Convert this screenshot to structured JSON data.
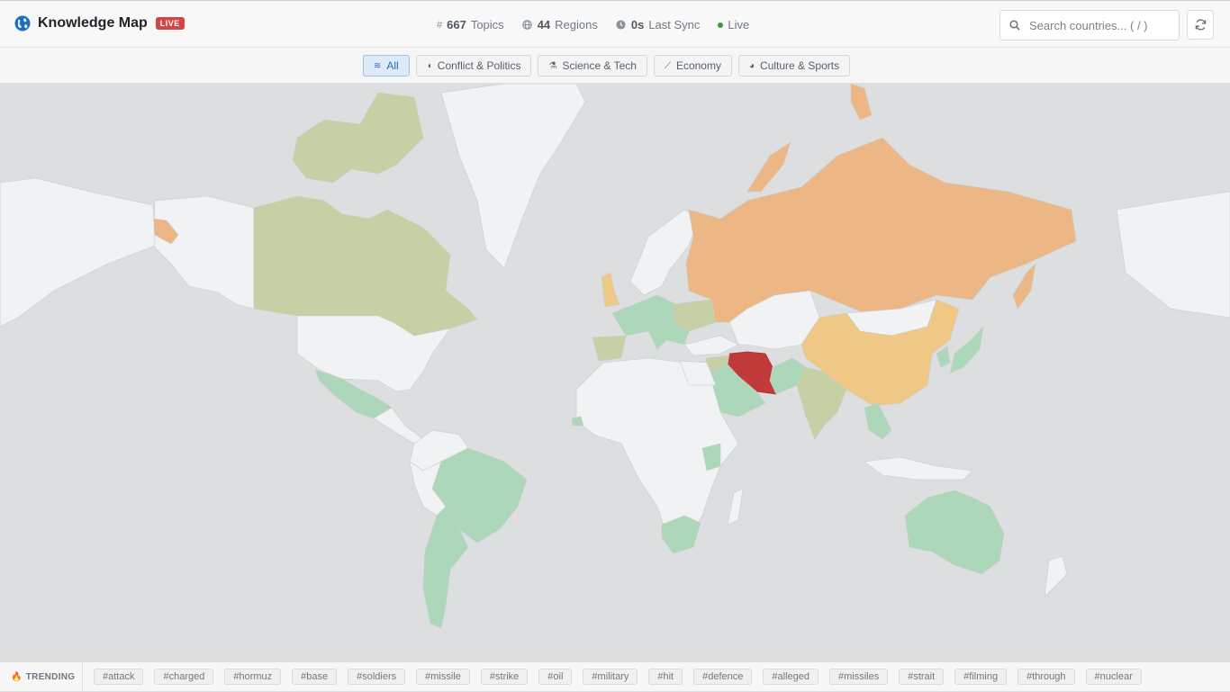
{
  "app": {
    "title": "Knowledge Map",
    "live_badge": "LIVE"
  },
  "stats": [
    {
      "icon": "hash-icon",
      "value": "667",
      "label": "Topics"
    },
    {
      "icon": "globe-icon",
      "value": "44",
      "label": "Regions"
    },
    {
      "icon": "clock-icon",
      "value": "0s",
      "label": "Last Sync"
    }
  ],
  "status": {
    "label": "Live",
    "color": "#2e9e45"
  },
  "search": {
    "placeholder": "Search countries... ( / )",
    "value": ""
  },
  "filters": [
    {
      "label": "All",
      "icon": "layers-icon",
      "active": true
    },
    {
      "label": "Conflict & Politics",
      "icon": "shield-icon",
      "active": false
    },
    {
      "label": "Science & Tech",
      "icon": "flask-icon",
      "active": false
    },
    {
      "label": "Economy",
      "icon": "chart-icon",
      "active": false
    },
    {
      "label": "Culture & Sports",
      "icon": "palette-icon",
      "active": false
    }
  ],
  "trending": {
    "label": "TRENDING",
    "tags": [
      "#attack",
      "#charged",
      "#hormuz",
      "#base",
      "#soldiers",
      "#missile",
      "#strike",
      "#oil",
      "#military",
      "#hit",
      "#defence",
      "#alleged",
      "#missiles",
      "#strait",
      "#filming",
      "#through",
      "#nuclear"
    ]
  },
  "colors": {
    "accent": "#2b6cb0",
    "live_badge": "#d64545",
    "map_background": "#dcdedf",
    "no_data": "#f1f2f4",
    "level_1_green": "#acd7b9",
    "level_2_olive": "#c5d1a5",
    "level_3_yellow": "#f0c886",
    "level_4_orange": "#ecb784",
    "level_5_red": "#c03a3a"
  }
}
